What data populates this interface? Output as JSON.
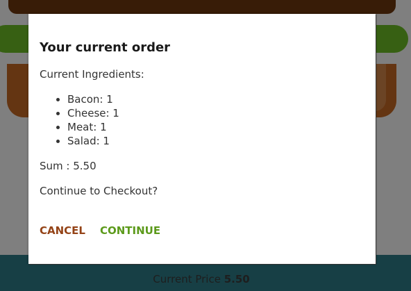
{
  "modal": {
    "title": "Your current order",
    "ingredients_label": "Current Ingredients:",
    "ingredients": [
      {
        "text": "Bacon: 1"
      },
      {
        "text": "Cheese: 1"
      },
      {
        "text": "Meat: 1"
      },
      {
        "text": "Salad: 1"
      }
    ],
    "sum_text": "Sum : 5.50",
    "prompt": "Continue to Checkout?",
    "cancel_label": "CANCEL",
    "continue_label": "CONTINUE"
  },
  "footer": {
    "price_label": "Current Price",
    "price_value": "5.50"
  },
  "colors": {
    "cancel": "#944317",
    "continue": "#5c9a1b",
    "footer_bg": "#2f7f8a",
    "bun": "#70380f",
    "salad": "#6fc126",
    "bacon": "#c96a24"
  }
}
